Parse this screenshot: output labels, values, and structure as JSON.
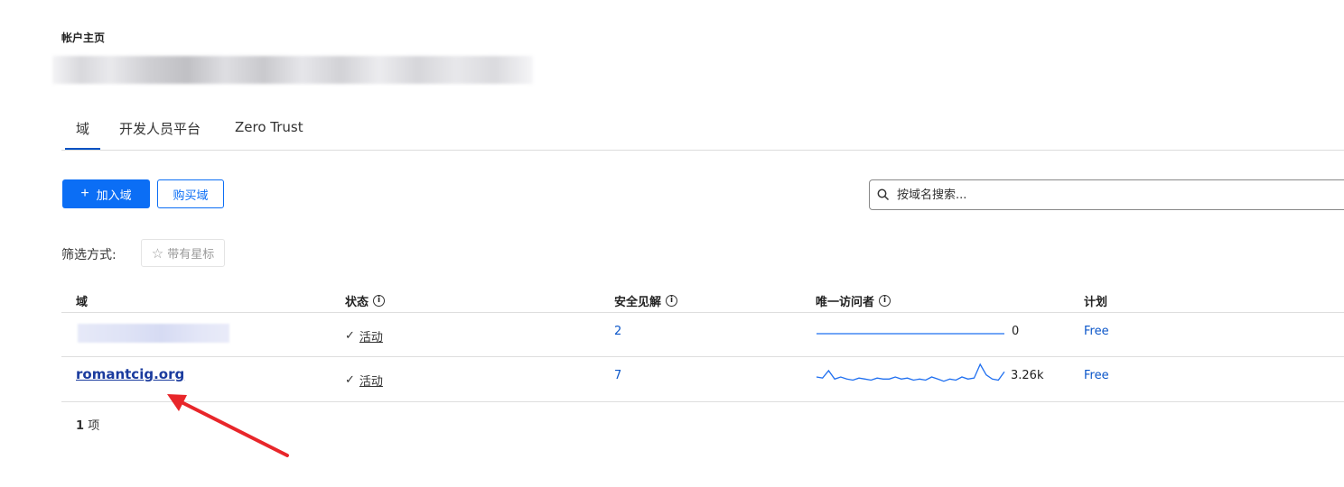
{
  "breadcrumb": "帐户主页",
  "tabs": [
    "域",
    "开发人员平台",
    "Zero Trust"
  ],
  "actions": {
    "add_domain": "加入域",
    "buy_domain": "购买域"
  },
  "search": {
    "placeholder": "按域名搜索..."
  },
  "filter": {
    "label": "筛选方式:",
    "starred": "带有星标"
  },
  "table": {
    "headers": [
      "域",
      "状态",
      "安全见解",
      "唯一访问者",
      "计划"
    ],
    "rows": [
      {
        "domain": "",
        "status": "活动",
        "insights": "2",
        "visitors": "0",
        "plan": "Free",
        "sparkline": [
          0,
          0,
          0,
          0,
          0,
          0,
          0,
          0,
          0,
          0,
          0,
          0,
          0,
          0,
          0,
          0,
          0,
          0,
          0,
          0,
          0,
          0,
          0,
          0
        ]
      },
      {
        "domain": "romantcig.org",
        "status": "活动",
        "insights": "7",
        "visitors": "3.26k",
        "plan": "Free",
        "sparkline": [
          12,
          11,
          18,
          10,
          12,
          10,
          9,
          11,
          10,
          9,
          11,
          10,
          10,
          12,
          10,
          11,
          9,
          10,
          9,
          12,
          10,
          8,
          10,
          9,
          12,
          10,
          11,
          24,
          14,
          10,
          9,
          17
        ]
      }
    ]
  },
  "count": {
    "number": "1",
    "unit": "项"
  },
  "colors": {
    "primary": "#0b6ef5",
    "link": "#1a3b9e",
    "sparkline": "#1f6ff0",
    "annotation": "#e8262a"
  }
}
